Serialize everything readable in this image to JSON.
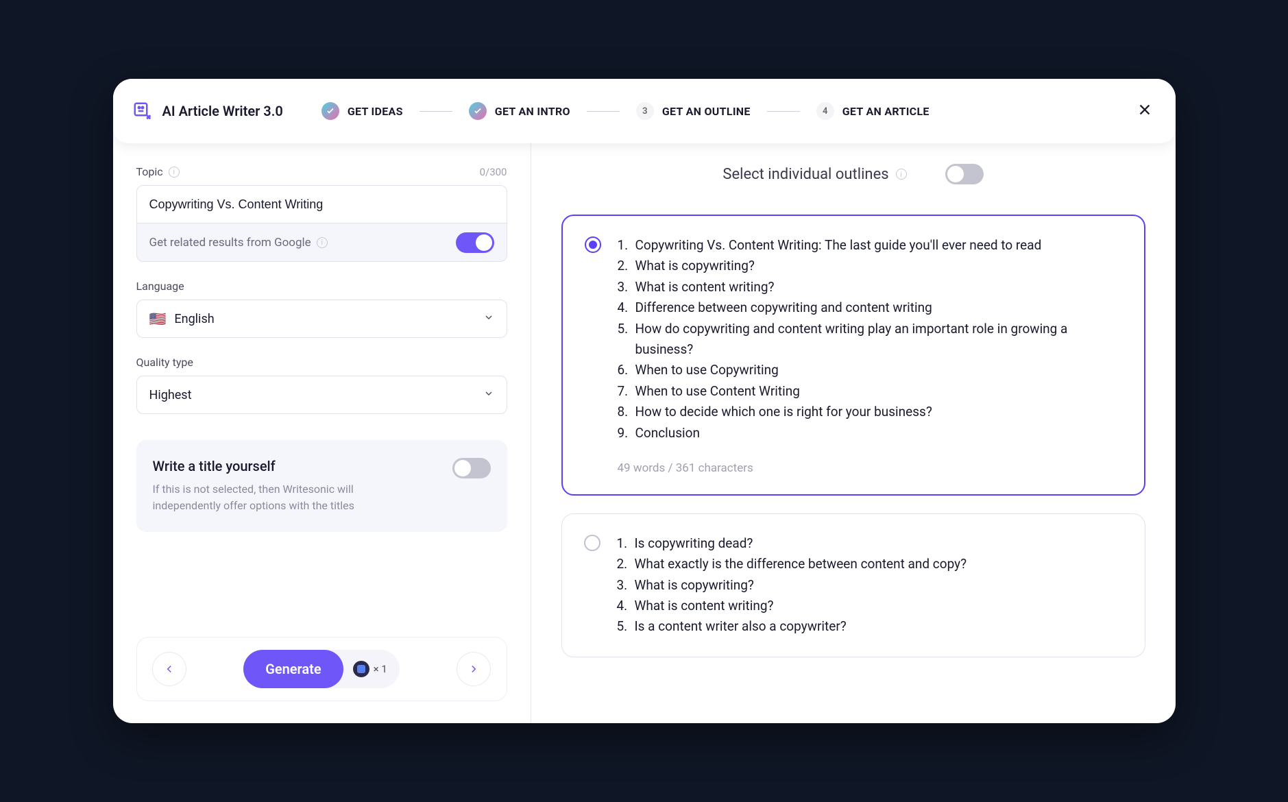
{
  "header": {
    "app_name": "AI Article Writer 3.0",
    "steps": [
      {
        "label": "GET IDEAS",
        "state": "done"
      },
      {
        "label": "GET AN INTRO",
        "state": "done"
      },
      {
        "label": "GET AN OUTLINE",
        "state": "num",
        "num": "3"
      },
      {
        "label": "GET AN ARTICLE",
        "state": "num",
        "num": "4"
      }
    ]
  },
  "left": {
    "topic_label": "Topic",
    "topic_counter": "0/300",
    "topic_value": "Copywriting Vs. Content Writing",
    "google_label": "Get related results from Google",
    "language_label": "Language",
    "language_value": "English",
    "quality_label": "Quality type",
    "quality_value": "Highest",
    "title_card": {
      "heading": "Write a title yourself",
      "desc": "If this is not selected, then Writesonic will independently offer options with the titles"
    },
    "generate_label": "Generate",
    "generate_meta": "× 1"
  },
  "right": {
    "top_label": "Select individual outlines",
    "outlines": [
      {
        "selected": true,
        "items": [
          "Copywriting Vs. Content Writing: The last guide you'll ever need to read",
          "What is copywriting?",
          "What is content writing?",
          "Difference between copywriting and content writing",
          "How do copywriting and content writing play an important role in growing a business?",
          "When to use Copywriting",
          "When to use Content Writing",
          "How to decide which one is right for your business?",
          "Conclusion"
        ],
        "meta": "49 words / 361 characters"
      },
      {
        "selected": false,
        "items": [
          "Is copywriting dead?",
          "What exactly is the difference between content and copy?",
          "What is copywriting?",
          "What is content writing?",
          "Is a content writer also a copywriter?"
        ],
        "meta": ""
      }
    ]
  }
}
